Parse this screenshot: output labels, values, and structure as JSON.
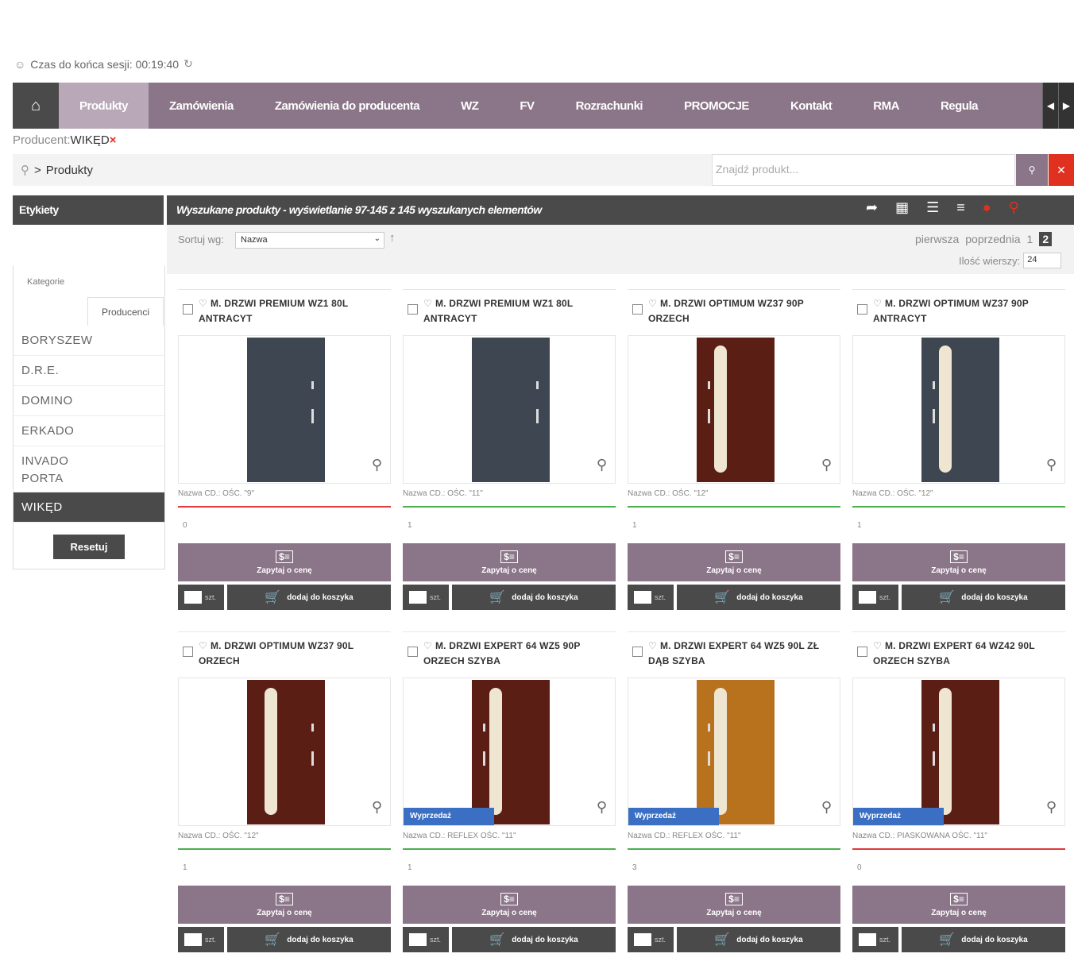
{
  "session": {
    "label": "Czas do końca sesji: 00:19:40"
  },
  "nav": {
    "items": [
      "Produkty",
      "Zamówienia",
      "Zamówienia do producenta",
      "WZ",
      "FV",
      "Rozrachunki",
      "PROMOCJE",
      "Kontakt",
      "RMA",
      "Regula"
    ],
    "active": "Produkty"
  },
  "producer_filter": {
    "label": "Producent:",
    "value": "WIKĘD",
    "remove": "×"
  },
  "breadcrumb": {
    "current": "Produkty"
  },
  "search": {
    "placeholder": "Znajdź produkt..."
  },
  "sidebar": {
    "title": "Etykiety",
    "categories_tab": "Kategorie",
    "producers_tab": "Producenci",
    "producers": [
      "BORYSZEW",
      "D.R.E.",
      "DOMINO",
      "ERKADO",
      "INVADO",
      "PORTA",
      "WIKĘD"
    ],
    "active_producer": "WIKĘD",
    "reset": "Resetuj"
  },
  "results": {
    "title": "Wyszukane produkty - wyświetlanie 97-145 z 145 wyszukanych elementów",
    "sort_label": "Sortuj wg:",
    "sort_value": "Nazwa",
    "pager": {
      "first": "pierwsza",
      "prev": "poprzednia",
      "pages": [
        "1",
        "2"
      ],
      "current": "2"
    },
    "rows_label": "Ilość wierszy:",
    "rows_value": "24"
  },
  "card_labels": {
    "cd_label": "Nazwa CD.:",
    "ask": "Zapytaj o cenę",
    "qty_unit": "szt.",
    "add_to_cart": "dodaj do koszyka",
    "sale": "Wyprzedaż"
  },
  "products": [
    {
      "title": "M. DRZWI PREMIUM WZ1 80L ANTRACYT",
      "cd": "OŚC. \"9\"",
      "stock": "0",
      "status_color": "#e03a3a",
      "door_color": "#3d4651",
      "sale": false
    },
    {
      "title": "M. DRZWI PREMIUM WZ1 80L ANTRACYT",
      "cd": "OŚC. \"11\"",
      "stock": "1",
      "status_color": "#4caf50",
      "door_color": "#3d4651",
      "sale": false
    },
    {
      "title": "M. DRZWI OPTIMUM WZ37 90P ORZECH",
      "cd": "OŚC. \"12\"",
      "stock": "1",
      "status_color": "#4caf50",
      "door_color": "#5a1e14",
      "sale": false
    },
    {
      "title": "M. DRZWI OPTIMUM WZ37 90P ANTRACYT",
      "cd": "OŚC. \"12\"",
      "stock": "1",
      "status_color": "#4caf50",
      "door_color": "#3d4651",
      "sale": false
    },
    {
      "title": "M. DRZWI OPTIMUM WZ37 90L ORZECH",
      "cd": "OŚC. \"12\"",
      "stock": "1",
      "status_color": "#4caf50",
      "door_color": "#5a1e14",
      "sale": false
    },
    {
      "title": "M. DRZWI EXPERT 64 WZ5 90P ORZECH SZYBA",
      "cd": "REFLEX OŚC. \"11\"",
      "stock": "1",
      "status_color": "#4caf50",
      "door_color": "#5a1e14",
      "sale": true
    },
    {
      "title": "M. DRZWI EXPERT 64 WZ5 90L ZŁ DĄB SZYBA",
      "cd": "REFLEX OŚC. \"11\"",
      "stock": "3",
      "status_color": "#4caf50",
      "door_color": "#b8721e",
      "sale": true
    },
    {
      "title": "M. DRZWI EXPERT 64 WZ42 90L ORZECH SZYBA",
      "cd": "PIASKOWANA OŚC. \"11\"",
      "stock": "0",
      "status_color": "#e03a3a",
      "door_color": "#5a1e14",
      "sale": true
    }
  ]
}
